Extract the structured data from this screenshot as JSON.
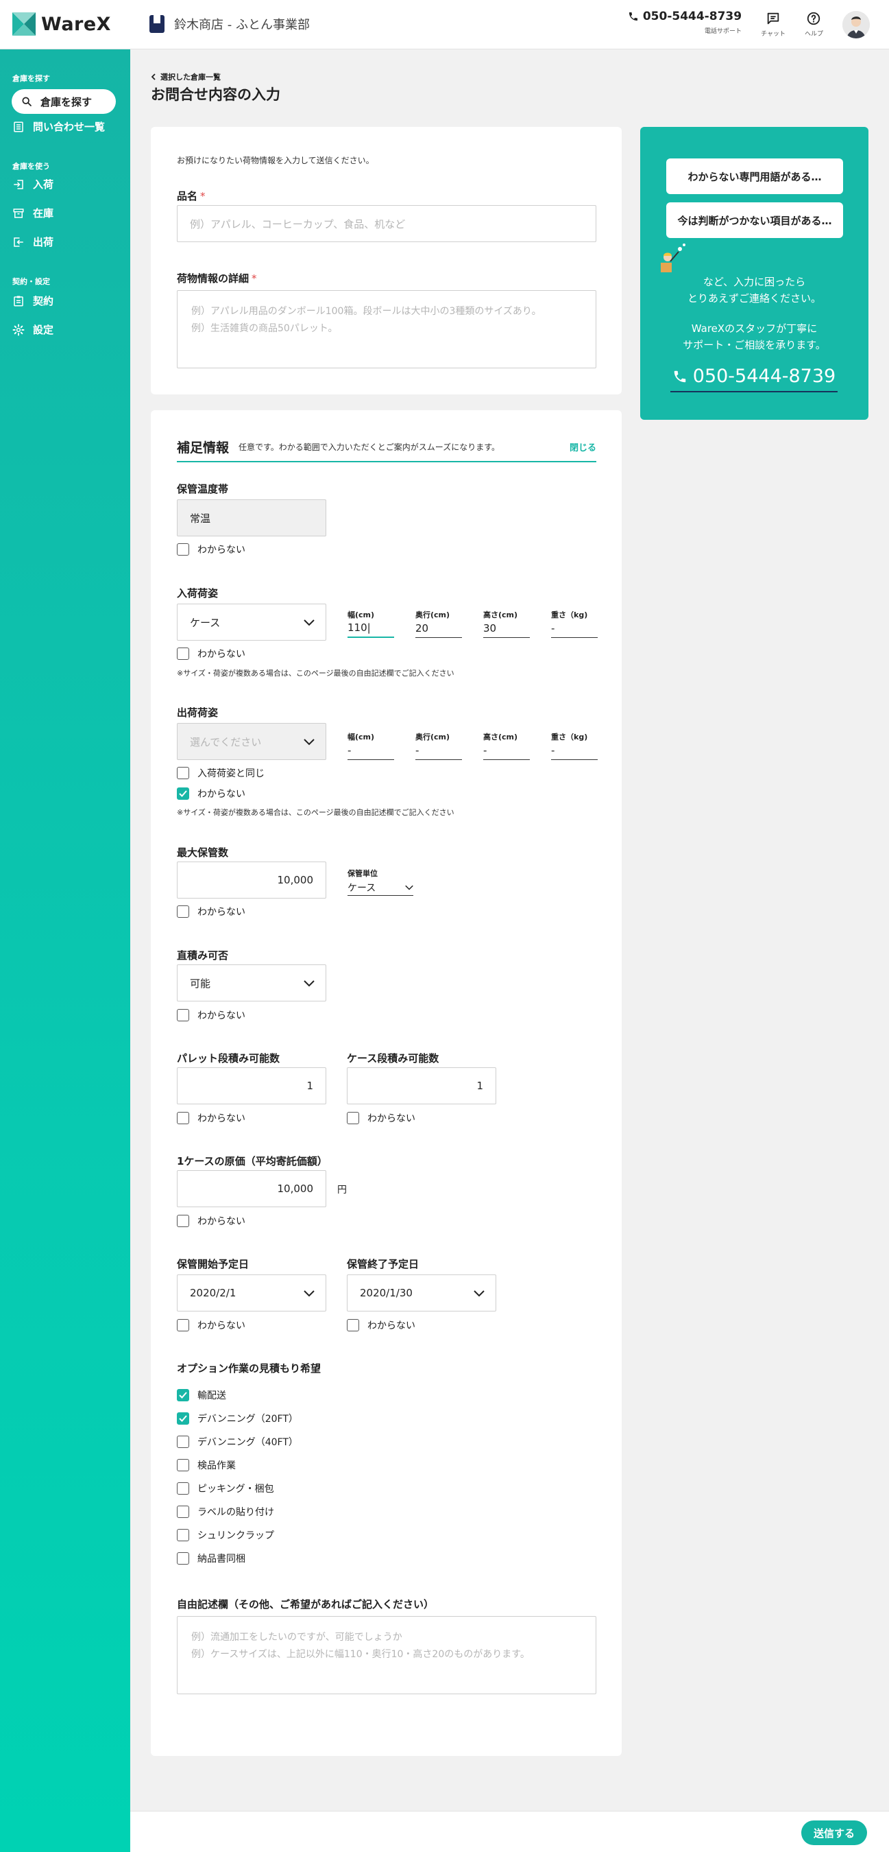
{
  "header": {
    "logo": "WareX",
    "company": "鈴木商店 - ふとん事業部",
    "phone": "050-5444-8739",
    "phone_caption": "電話サポート",
    "chat": "チャット",
    "help": "ヘルプ"
  },
  "sidebar": {
    "section1": "倉庫を探す",
    "search": "倉庫を探す",
    "inquiries": "問い合わせ一覧",
    "section2": "倉庫を使う",
    "inbound": "入荷",
    "stock": "在庫",
    "outbound": "出荷",
    "section3": "契約・設定",
    "contract": "契約",
    "settings": "設定"
  },
  "page": {
    "breadcrumb": "選択した倉庫一覧",
    "title": "お問合せ内容の入力"
  },
  "form1": {
    "intro": "お預けになりたい荷物情報を入力して送信ください。",
    "item_label": "品名",
    "item_placeholder": "例）アパレル、コーヒーカップ、食品、机など",
    "detail_label": "荷物情報の詳細",
    "detail_placeholder_1": "例）アパレル用品のダンボール100箱。段ボールは大中小の3種類のサイズあり。",
    "detail_placeholder_2": "例）生活雑貨の商品50パレット。"
  },
  "help": {
    "btn1": "わからない専門用語がある…",
    "btn2": "今は判断がつかない項目がある…",
    "text1_a": "など、入力に困ったら",
    "text1_b": "とりあえずご連絡ください。",
    "text2_a": "WareXのスタッフが丁寧に",
    "text2_b": "サポート・ご相談を承ります。",
    "phone": "050-5444-8739"
  },
  "form2": {
    "heading": "補足情報",
    "subtitle": "任意です。わかる範囲で入力いただくとご案内がスムーズになります。",
    "close": "閉じる",
    "unknown": "わからない",
    "temp_label": "保管温度帯",
    "temp_value": "常温",
    "inbound_label": "入荷荷姿",
    "inbound_value": "ケース",
    "width": "幅(cm)",
    "depth": "奥行(cm)",
    "height": "高さ(cm)",
    "weight": "重さ（kg)",
    "in_w": "110|",
    "in_d": "20",
    "in_h": "30",
    "in_kg": "-",
    "size_note": "※サイズ・荷姿が複数ある場合は、このページ最後の自由記述欄でご記入ください",
    "outbound_label": "出荷荷姿",
    "outbound_placeholder": "選んでください",
    "out_w": "-",
    "out_d": "-",
    "out_h": "-",
    "out_kg": "-",
    "same_as_inbound": "入荷荷姿と同じ",
    "max_label": "最大保管数",
    "max_value": "10,000",
    "unit_label": "保管単位",
    "unit_value": "ケース",
    "direct_label": "直積み可否",
    "direct_value": "可能",
    "pallet_label": "パレット段積み可能数",
    "pallet_value": "1",
    "case_label": "ケース段積み可能数",
    "case_value": "1",
    "cost_label": "1ケースの原価（平均寄託価額）",
    "cost_value": "10,000",
    "yen": "円",
    "start_label": "保管開始予定日",
    "start_value": "2020/2/1",
    "end_label": "保管終了予定日",
    "end_value": "2020/1/30",
    "options_label": "オプション作業の見積もり希望",
    "options": [
      "輸配送",
      "デバンニング（20FT）",
      "デバンニング（40FT）",
      "検品作業",
      "ピッキング・梱包",
      "ラベルの貼り付け",
      "シュリンクラップ",
      "納品書同梱"
    ],
    "free_label": "自由記述欄（その他、ご希望があればご記入ください）",
    "free_placeholder_1": "例）流通加工をしたいのですが、可能でしょうか",
    "free_placeholder_2": "例）ケースサイズは、上記以外に幅110・奥行10・高さ20のものがあります。"
  },
  "footer": {
    "submit": "送信する"
  },
  "colors": {
    "accent": "#18b6a6",
    "required": "#e04848",
    "navy": "#1e2c5a"
  }
}
